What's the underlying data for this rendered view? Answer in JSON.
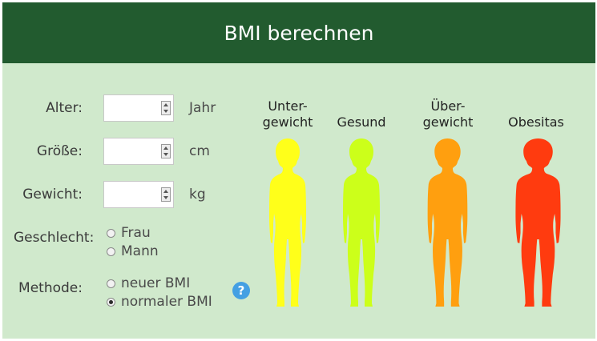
{
  "header": {
    "title": "BMI berechnen"
  },
  "form": {
    "age": {
      "label": "Alter:",
      "value": "",
      "unit": "Jahr"
    },
    "height": {
      "label": "Größe:",
      "value": "",
      "unit": "cm"
    },
    "weight": {
      "label": "Gewicht:",
      "value": "",
      "unit": "kg"
    },
    "gender": {
      "label": "Geschlecht:",
      "options": [
        {
          "label": "Frau",
          "checked": false
        },
        {
          "label": "Mann",
          "checked": false
        }
      ]
    },
    "method": {
      "label": "Methode:",
      "options": [
        {
          "label": "neuer BMI",
          "checked": false
        },
        {
          "label": "normaler BMI",
          "checked": true
        }
      ],
      "help_label": "?"
    }
  },
  "categories": [
    {
      "line1": "Unter-",
      "line2": "gewicht",
      "color": "#ffff1a",
      "icon": "female-silhouette-icon"
    },
    {
      "line1": "",
      "line2": "Gesund",
      "color": "#ccff1a",
      "icon": "female-silhouette-icon"
    },
    {
      "line1": "Über-",
      "line2": "gewicht",
      "color": "#ff9f0f",
      "icon": "female-silhouette-icon"
    },
    {
      "line1": "",
      "line2": "Obesitas",
      "color": "#ff3b0f",
      "icon": "female-silhouette-icon"
    }
  ],
  "colors": {
    "header_bg": "#225b2f",
    "panel_bg": "#d0e9cc",
    "help_icon": "#44a0e3"
  }
}
